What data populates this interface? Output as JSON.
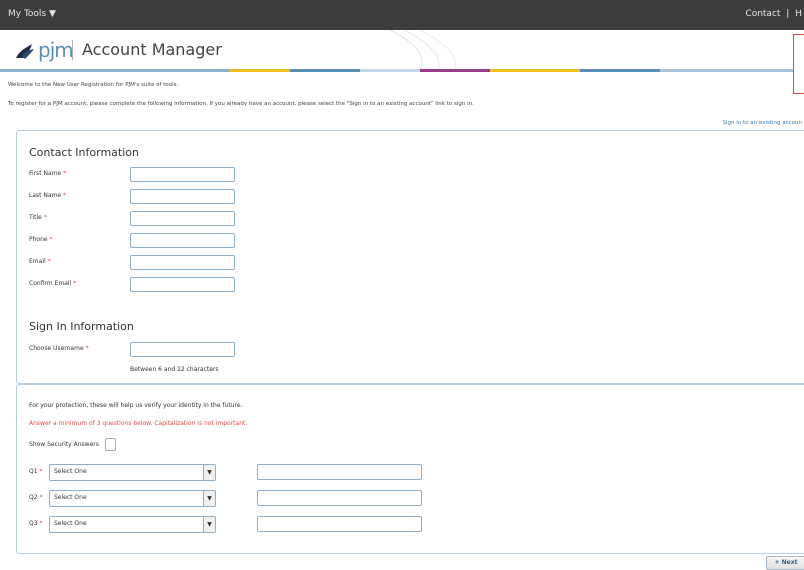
{
  "topbar": {
    "my_tools": "My Tools ▼",
    "contact": "Contact",
    "divider": "|",
    "cut_item": "H"
  },
  "header": {
    "logo_text": "pjm",
    "app_title": "Account Manager"
  },
  "intro": {
    "welcome": "Welcome to the New User Registration for PJM's suite of tools.",
    "instructions": "To register for a PJM account, please complete the following information. If you already have an account, please select the \"Sign in to an existing account\" link to sign in.",
    "signin_link": "Sign in to an existing accoun"
  },
  "contact_info": {
    "title": "Contact Information",
    "fields": [
      {
        "label": "First Name",
        "required": "*",
        "value": ""
      },
      {
        "label": "Last Name",
        "required": "*",
        "value": ""
      },
      {
        "label": "Title",
        "required": "*",
        "value": ""
      },
      {
        "label": "Phone",
        "required": "*",
        "value": ""
      },
      {
        "label": "Email",
        "required": "*",
        "value": ""
      },
      {
        "label": "Confirm Email",
        "required": "*",
        "value": ""
      }
    ]
  },
  "signin_info": {
    "title": "Sign In Information",
    "username_label": "Choose Username",
    "required": "*",
    "username_value": "",
    "username_hint": "Between 6 and 12 characters"
  },
  "security": {
    "protection_text": "For your protection, these will help us verify your identity in the future.",
    "warning_text": "Answer a minimum of 3 questions below. Capitalization is not important.",
    "show_answers_label": "Show Security Answers",
    "show_answers_checked": false,
    "questions": [
      {
        "label": "Q1",
        "required": "*",
        "selected": "Select One",
        "answer": ""
      },
      {
        "label": "Q2",
        "required": "*",
        "selected": "Select One",
        "answer": ""
      },
      {
        "label": "Q3",
        "required": "*",
        "selected": "Select One",
        "answer": ""
      }
    ]
  },
  "footer": {
    "next_label": "+ Next"
  },
  "colors": {
    "topbar_bg": "#3c3c3c",
    "panel_border": "#b9cfe2",
    "input_border": "#8fb0cc",
    "required": "#e04a4a",
    "link": "#3a78b0",
    "brand_blue": "#5a8fb3"
  }
}
